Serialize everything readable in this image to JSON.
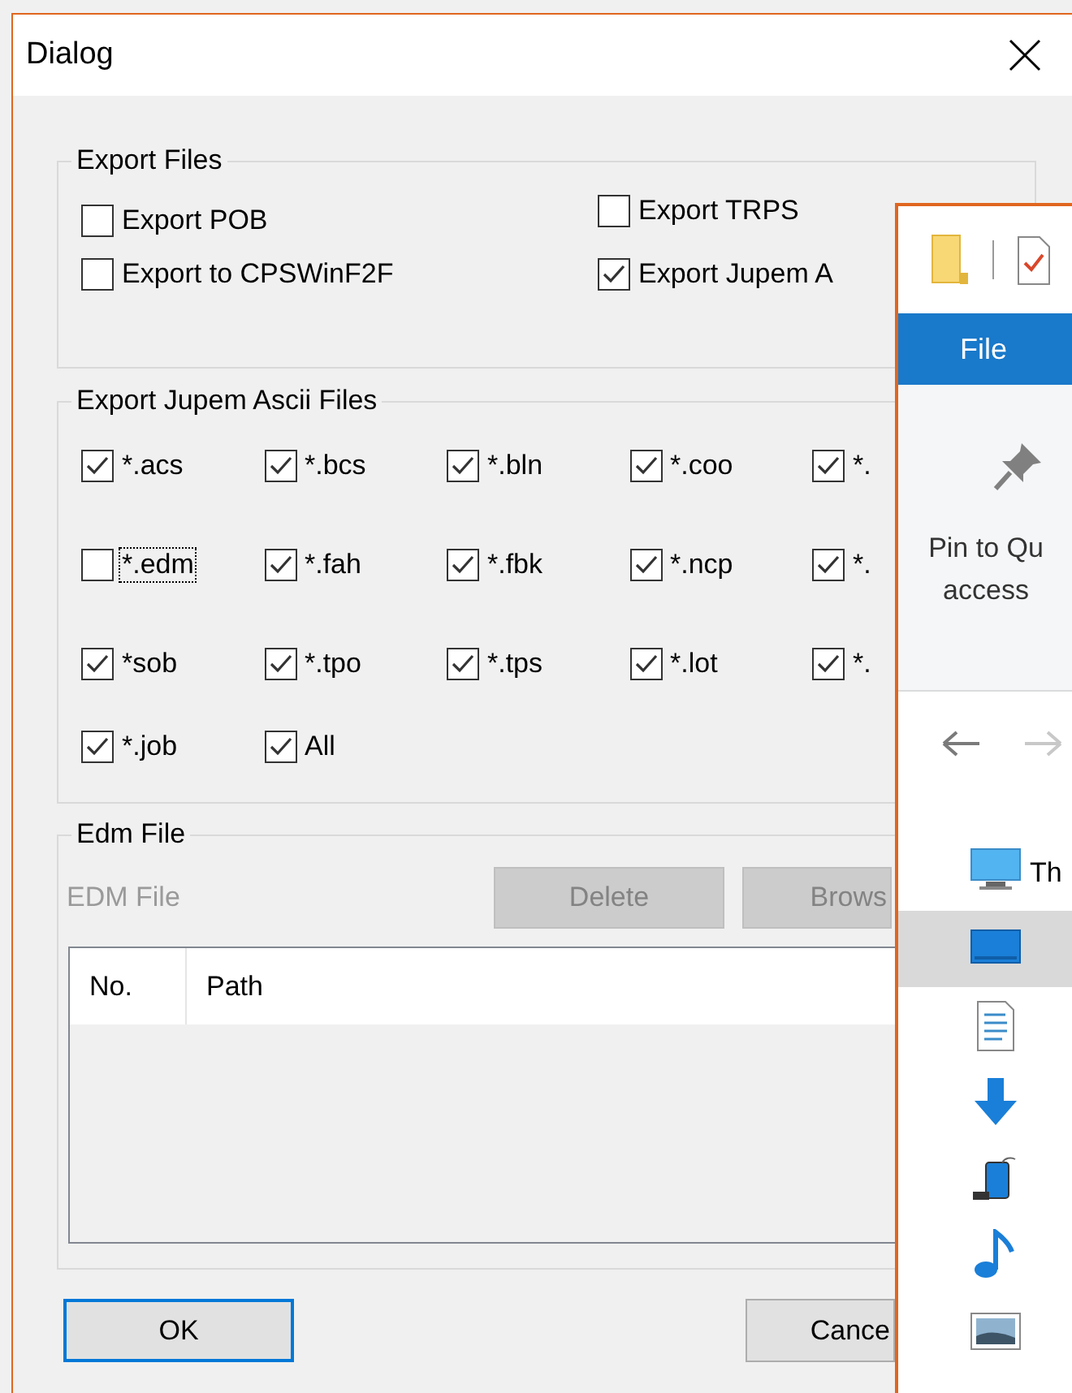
{
  "window": {
    "title": "Dialog"
  },
  "export_files": {
    "title": "Export Files",
    "options": [
      {
        "label": "Export POB",
        "checked": false
      },
      {
        "label": "Export TRPS",
        "checked": false
      },
      {
        "label": "Export to CPSWinF2F",
        "checked": false
      },
      {
        "label": "Export Jupem A",
        "checked": true
      }
    ]
  },
  "ascii_files": {
    "title": "Export Jupem Ascii Files",
    "options": [
      {
        "label": "*.acs",
        "checked": true,
        "focused": false
      },
      {
        "label": "*.bcs",
        "checked": true,
        "focused": false
      },
      {
        "label": "*.bln",
        "checked": true,
        "focused": false
      },
      {
        "label": "*.coo",
        "checked": true,
        "focused": false
      },
      {
        "label": "*.",
        "checked": true,
        "focused": false
      },
      {
        "label": "*.edm",
        "checked": false,
        "focused": true
      },
      {
        "label": "*.fah",
        "checked": true,
        "focused": false
      },
      {
        "label": "*.fbk",
        "checked": true,
        "focused": false
      },
      {
        "label": "*.ncp",
        "checked": true,
        "focused": false
      },
      {
        "label": "*.",
        "checked": true,
        "focused": false
      },
      {
        "label": "*sob",
        "checked": true,
        "focused": false
      },
      {
        "label": "*.tpo",
        "checked": true,
        "focused": false
      },
      {
        "label": "*.tps",
        "checked": true,
        "focused": false
      },
      {
        "label": "*.lot",
        "checked": true,
        "focused": false
      },
      {
        "label": "*.",
        "checked": true,
        "focused": false
      },
      {
        "label": "*.job",
        "checked": true,
        "focused": false
      },
      {
        "label": "All",
        "checked": true,
        "focused": false
      }
    ]
  },
  "edm_file": {
    "title": "Edm File",
    "label": "EDM File",
    "label_disabled": true,
    "buttons": [
      {
        "label": "Delete",
        "disabled": true
      },
      {
        "label": "Brows",
        "disabled": true
      }
    ],
    "table": {
      "columns": [
        "No.",
        "Path"
      ]
    }
  },
  "buttons": [
    {
      "label": "OK",
      "default": true
    },
    {
      "label": "Cance",
      "default": false
    }
  ],
  "explorer": {
    "tab": "File",
    "ribbon_button": "Pin to Qu access",
    "nav_items": [
      {
        "kind": "pc",
        "label": "Th",
        "selected": false
      },
      {
        "kind": "desktop",
        "selected": true
      },
      {
        "kind": "documents",
        "selected": false
      },
      {
        "kind": "downloads",
        "selected": false
      },
      {
        "kind": "device",
        "selected": false
      },
      {
        "kind": "music",
        "selected": false
      },
      {
        "kind": "pictures",
        "selected": false
      }
    ]
  }
}
